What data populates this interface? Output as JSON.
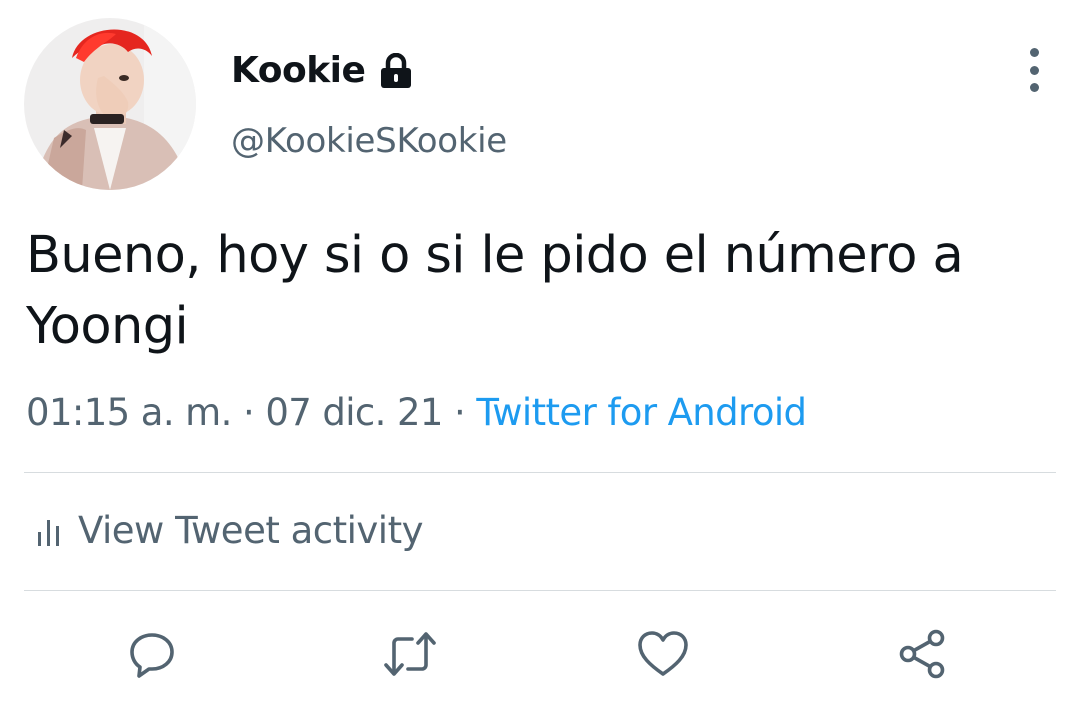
{
  "author": {
    "display_name": "Kookie",
    "handle": "@KookieSKookie",
    "protected_icon": "lock-icon",
    "avatar_description_icon": "avatar"
  },
  "tweet": {
    "text": "Bueno, hoy si o si le pido el número a Yoongi",
    "time": "01:15 a. m.",
    "separator": "·",
    "date": "07 dic. 21",
    "source": "Twitter for Android"
  },
  "activity": {
    "label": "View Tweet activity",
    "icon": "bar-chart-icon"
  },
  "actions": {
    "reply_icon": "reply-icon",
    "retweet_icon": "retweet-icon",
    "like_icon": "heart-icon",
    "share_icon": "share-icon"
  },
  "colors": {
    "text_primary": "#0f1419",
    "text_secondary": "#536471",
    "link": "#1d9bf0",
    "divider": "#d7dcdf"
  }
}
